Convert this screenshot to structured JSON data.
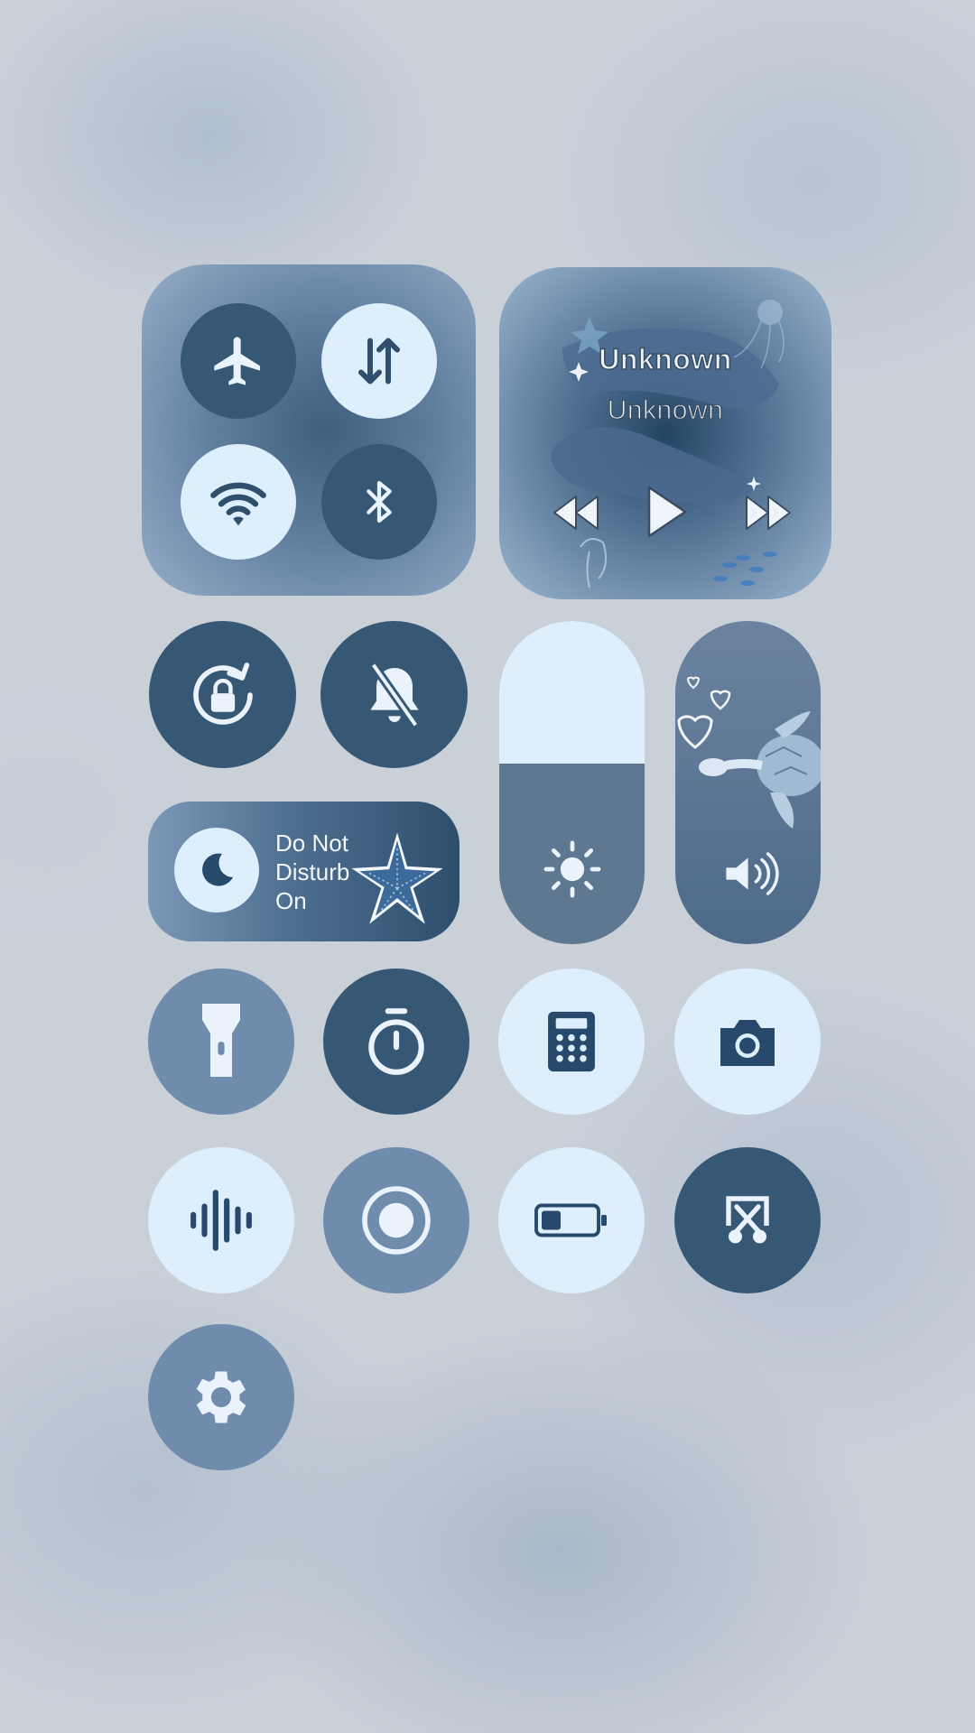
{
  "connectivity": {
    "airplane_mode": {
      "icon": "airplane-icon",
      "state": "off"
    },
    "mobile_data": {
      "icon": "data-transfer-icon",
      "state": "on"
    },
    "wifi": {
      "icon": "wifi-icon",
      "state": "on"
    },
    "bluetooth": {
      "icon": "bluetooth-icon",
      "state": "off"
    }
  },
  "media": {
    "title": "Unknown",
    "artist": "Unknown",
    "controls": [
      "previous-icon",
      "play-icon",
      "next-icon"
    ]
  },
  "toggles_row1": {
    "rotation_lock": {
      "icon": "rotation-lock-icon",
      "state": "on"
    },
    "silent": {
      "icon": "bell-off-icon",
      "state": "on"
    }
  },
  "do_not_disturb": {
    "label": "Do Not Disturb",
    "line1": "Do Not",
    "line2": "Disturb",
    "status": "On",
    "icon": "moon-icon"
  },
  "brightness": {
    "icon": "sun-icon",
    "level": 0.56
  },
  "volume": {
    "icon": "speaker-icon"
  },
  "tiles": [
    {
      "name": "flashlight",
      "icon": "flashlight-icon",
      "state": "neutral"
    },
    {
      "name": "timer",
      "icon": "stopwatch-icon",
      "state": "dark"
    },
    {
      "name": "calculator",
      "icon": "calculator-icon",
      "state": "light"
    },
    {
      "name": "camera",
      "icon": "camera-icon",
      "state": "light"
    },
    {
      "name": "sound-recognition",
      "icon": "soundwave-icon",
      "state": "light"
    },
    {
      "name": "screen-record",
      "icon": "record-icon",
      "state": "neutral"
    },
    {
      "name": "battery-saver",
      "icon": "battery-icon",
      "state": "light"
    },
    {
      "name": "screenshot",
      "icon": "screenshot-icon",
      "state": "dark"
    },
    {
      "name": "settings",
      "icon": "gear-icon",
      "state": "neutral"
    }
  ],
  "colors": {
    "dark_tile": "#375875",
    "mid_tile": "#6f8cac",
    "light_tile": "#ddeefc"
  }
}
